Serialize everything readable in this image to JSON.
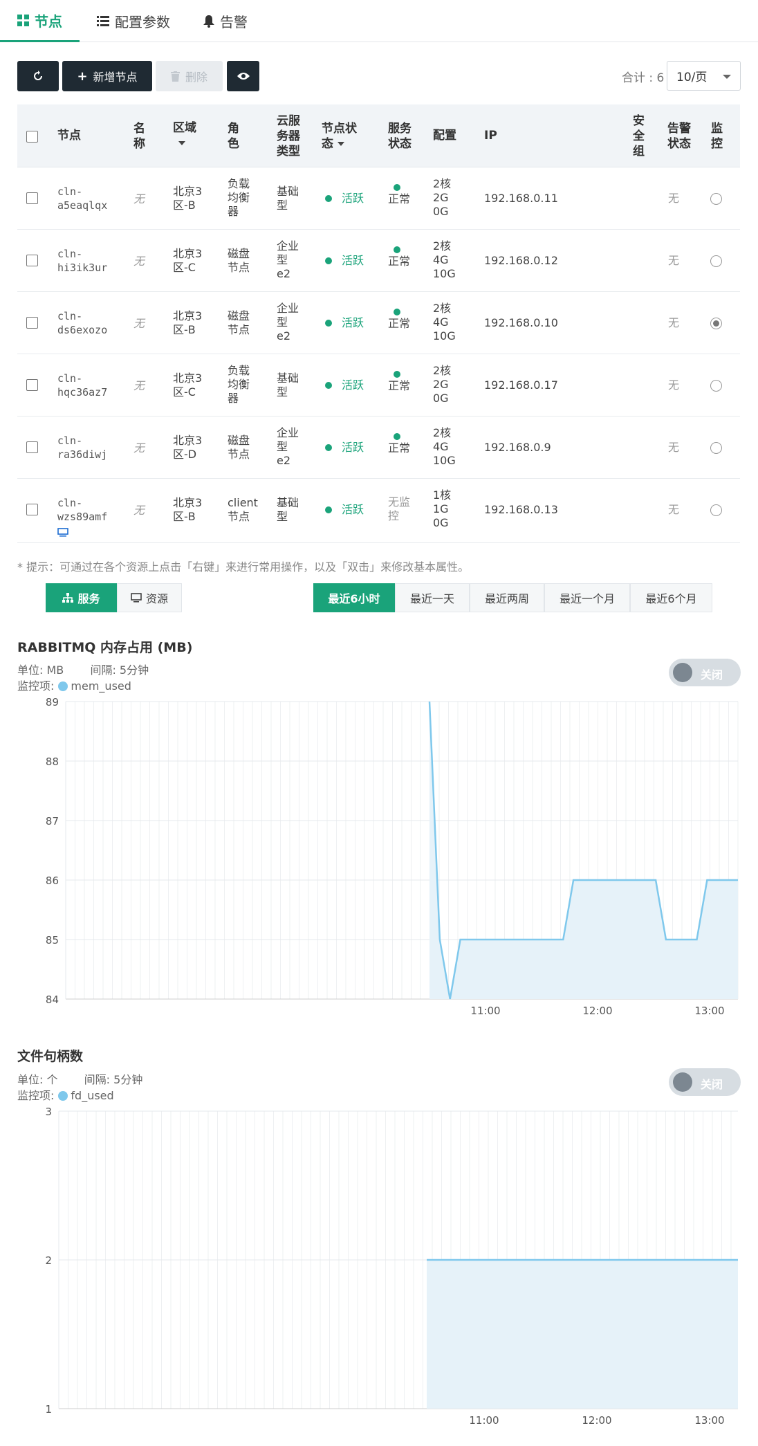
{
  "tabs": [
    {
      "label": "节点",
      "icon": "grid-icon"
    },
    {
      "label": "配置参数",
      "icon": "list-icon"
    },
    {
      "label": "告警",
      "icon": "bell-icon"
    }
  ],
  "toolbar": {
    "add_label": "新增节点",
    "delete_label": "删除",
    "total_label": "合计 : 6",
    "page_size": "10/页"
  },
  "table": {
    "headers": {
      "node": "节点",
      "name": "名\n称",
      "zone": "区域",
      "role": "角\n色",
      "cloud_type": "云服\n务器\n类型",
      "node_status": "节点状\n态",
      "service_status": "服务\n状态",
      "config": "配置",
      "ip": "IP",
      "security_group": "安\n全\n组",
      "alarm_status": "告警\n状态",
      "monitor": "监\n控"
    },
    "rows": [
      {
        "node": "cln-\na5eaqlqx",
        "name": "无",
        "zone": "北京3\n区-B",
        "role": "负载\n均衡\n器",
        "cloud_type": "基础\n型",
        "node_status": "活跃",
        "service_status": "正常",
        "config": "2核\n2G\n0G",
        "ip": "192.168.0.11",
        "alarm": "无",
        "monitor": false
      },
      {
        "node": "cln-\nhi3ik3ur",
        "name": "无",
        "zone": "北京3\n区-C",
        "role": "磁盘\n节点",
        "cloud_type": "企业\n型\ne2",
        "node_status": "活跃",
        "service_status": "正常",
        "config": "2核\n4G\n10G",
        "ip": "192.168.0.12",
        "alarm": "无",
        "monitor": false
      },
      {
        "node": "cln-\nds6exozo",
        "name": "无",
        "zone": "北京3\n区-B",
        "role": "磁盘\n节点",
        "cloud_type": "企业\n型\ne2",
        "node_status": "活跃",
        "service_status": "正常",
        "config": "2核\n4G\n10G",
        "ip": "192.168.0.10",
        "alarm": "无",
        "monitor": true
      },
      {
        "node": "cln-\nhqc36az7",
        "name": "无",
        "zone": "北京3\n区-C",
        "role": "负载\n均衡\n器",
        "cloud_type": "基础\n型",
        "node_status": "活跃",
        "service_status": "正常",
        "config": "2核\n2G\n0G",
        "ip": "192.168.0.17",
        "alarm": "无",
        "monitor": false
      },
      {
        "node": "cln-\nra36diwj",
        "name": "无",
        "zone": "北京3\n区-D",
        "role": "磁盘\n节点",
        "cloud_type": "企业\n型\ne2",
        "node_status": "活跃",
        "service_status": "正常",
        "config": "2核\n4G\n10G",
        "ip": "192.168.0.9",
        "alarm": "无",
        "monitor": false
      },
      {
        "node": "cln-\nwzs89amf",
        "name": "无",
        "zone": "北京3\n区-B",
        "role": "client\n节点",
        "cloud_type": "基础\n型",
        "node_status": "活跃",
        "service_status": "无监\n控",
        "config": "1核\n1G\n0G",
        "ip": "192.168.0.13",
        "alarm": "无",
        "monitor": false
      }
    ]
  },
  "hint": "* 提示：可通过在各个资源上点击「右键」来进行常用操作，以及「双击」来修改基本属性。",
  "view_switch": {
    "service": "服务",
    "resource": "资源"
  },
  "ranges": [
    "最近6小时",
    "最近一天",
    "最近两周",
    "最近一个月",
    "最近6个月"
  ],
  "colors": {
    "accent": "#1aa37a",
    "dark": "#1f2a33",
    "series": "#7fc8ec"
  },
  "chart_data": [
    {
      "type": "area",
      "title": "RABBITMQ 内存占用 (MB)",
      "unit_label": "单位: MB",
      "interval_label": "间隔: 5分钟",
      "metric_prefix": "监控项:",
      "series": [
        {
          "name": "mem_used",
          "values": [
            89,
            85,
            84,
            85,
            85,
            85,
            85,
            85,
            85,
            85,
            85,
            85,
            85,
            85,
            86,
            86,
            86,
            86,
            86,
            86,
            86,
            86,
            86,
            85,
            85,
            85,
            85,
            86,
            86,
            86,
            86
          ]
        }
      ],
      "ylim": [
        84,
        89
      ],
      "yticks": [
        84,
        85,
        86,
        87,
        88,
        89
      ],
      "xticks": [
        "11:00",
        "12:00",
        "13:00"
      ],
      "toggle": "关闭"
    },
    {
      "type": "area",
      "title": "文件句柄数",
      "unit_label": "单位: 个",
      "interval_label": "间隔: 5分钟",
      "metric_prefix": "监控项:",
      "series": [
        {
          "name": "fd_used",
          "values": [
            2,
            2,
            2,
            2,
            2,
            2,
            2,
            2,
            2,
            2,
            2,
            2,
            2,
            2,
            2,
            2,
            2,
            2,
            2,
            2,
            2,
            2,
            2,
            2,
            2,
            2,
            2,
            2,
            2,
            2,
            2,
            2,
            2,
            2
          ]
        }
      ],
      "ylim": [
        1,
        3
      ],
      "yticks": [
        1,
        2,
        3
      ],
      "xticks": [
        "11:00",
        "12:00",
        "13:00"
      ],
      "toggle": "关闭"
    }
  ]
}
